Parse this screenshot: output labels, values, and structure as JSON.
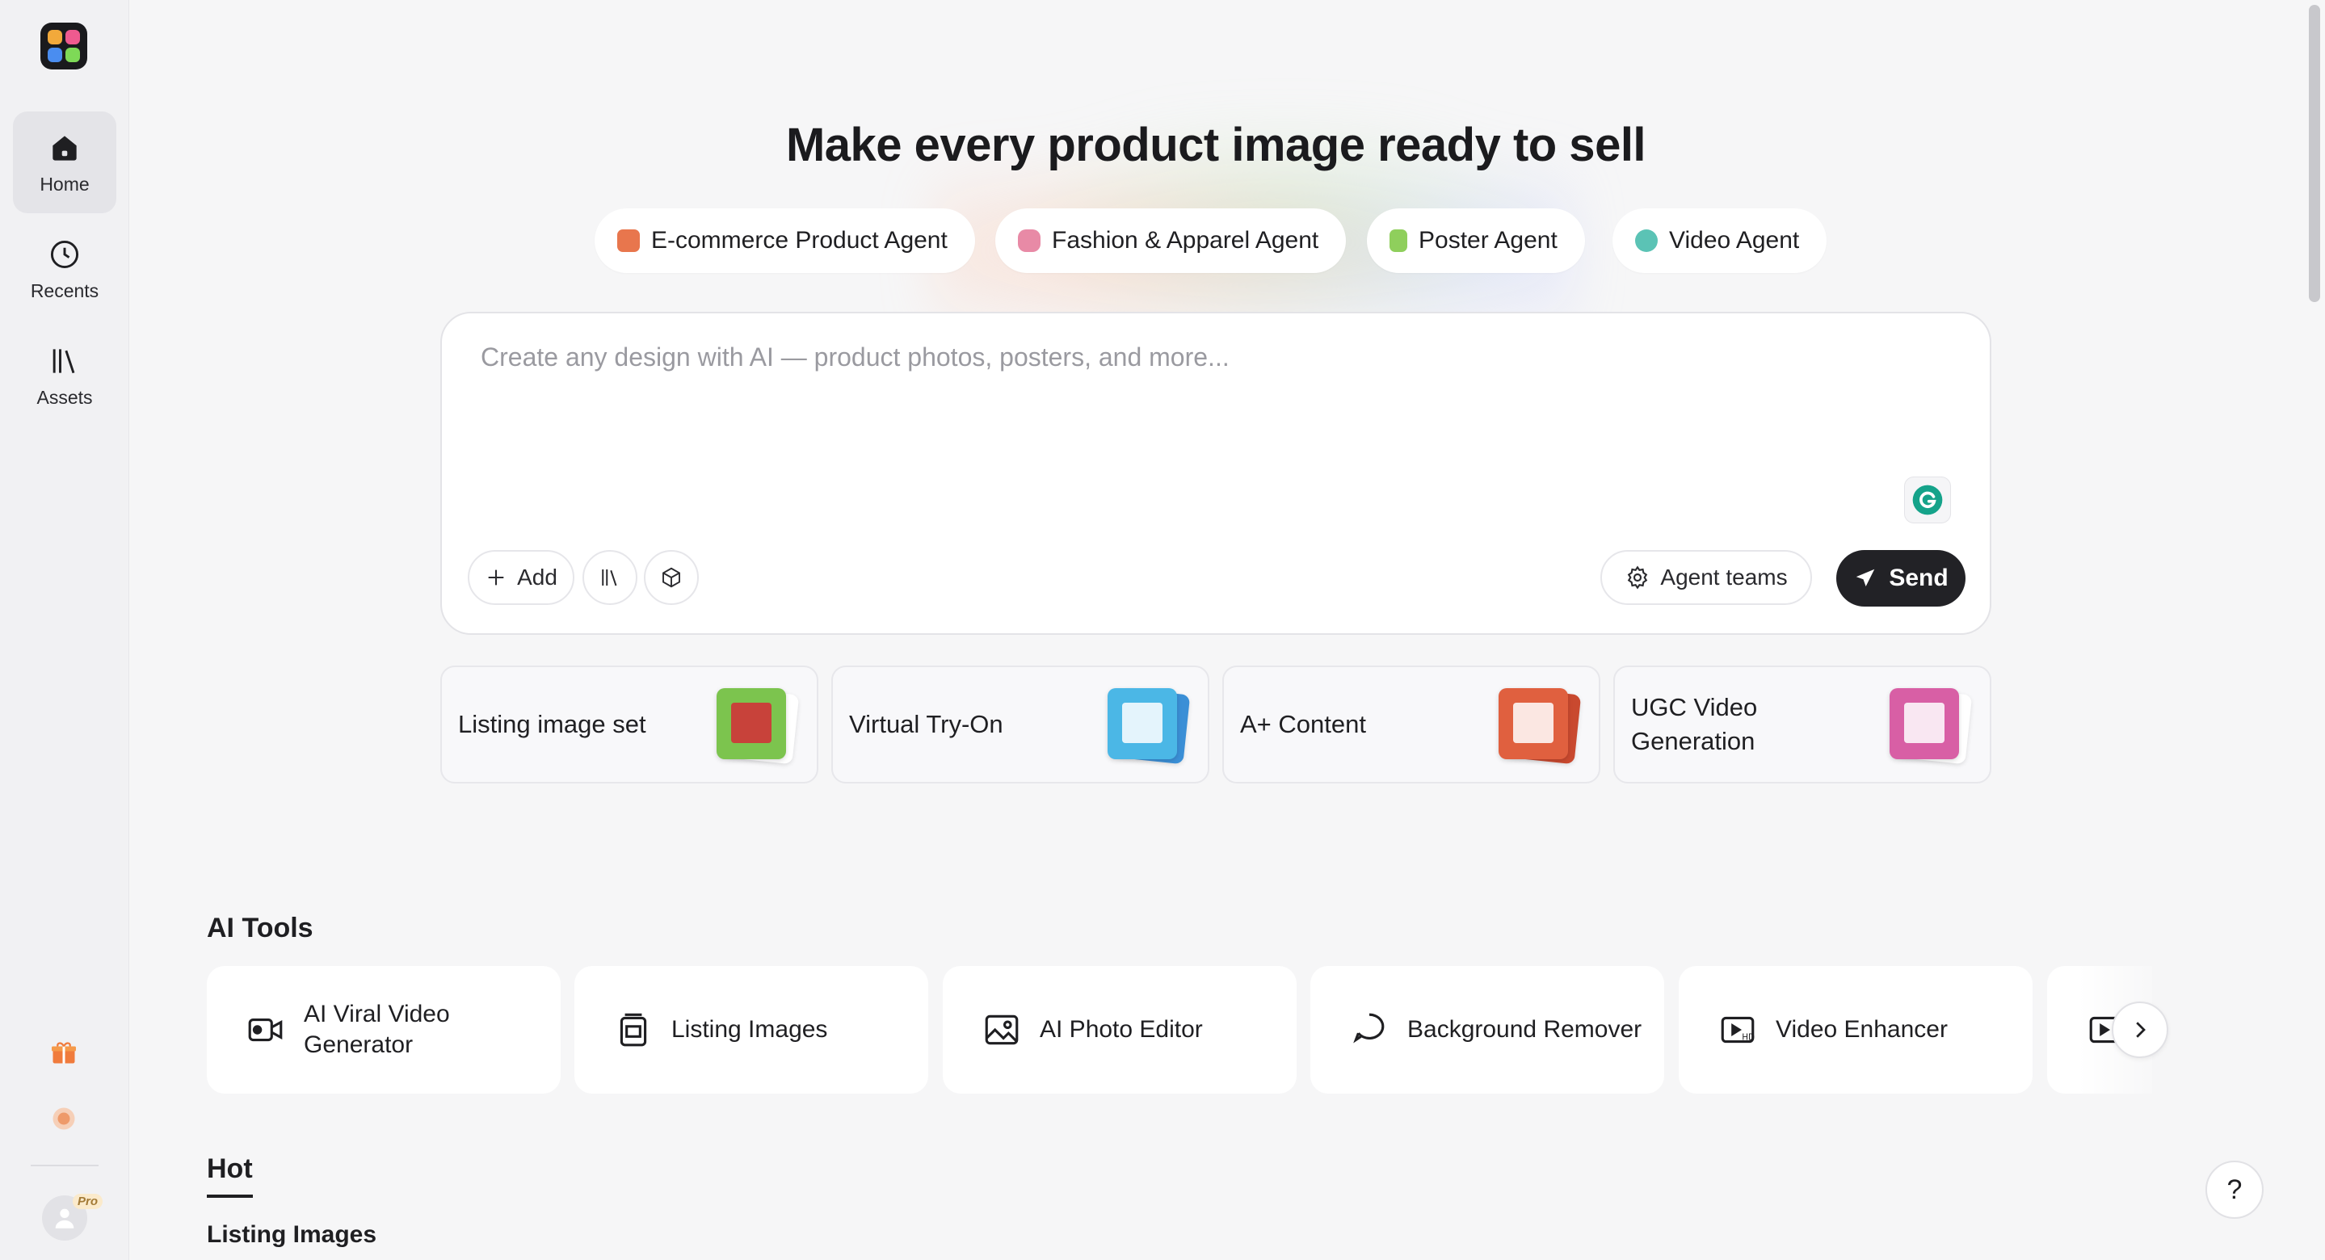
{
  "sidebar": {
    "items": [
      {
        "label": "Home",
        "icon": "home-icon",
        "active": true
      },
      {
        "label": "Recents",
        "icon": "clock-icon",
        "active": false
      },
      {
        "label": "Assets",
        "icon": "library-icon",
        "active": false
      }
    ],
    "pro_badge": "Pro"
  },
  "headline": "Make every product image ready to sell",
  "agents": [
    {
      "label": "E-commerce Product Agent",
      "icon": "sofa-icon",
      "color": "#e8764d"
    },
    {
      "label": "Fashion & Apparel Agent",
      "icon": "shirt-icon",
      "color": "#e88aa6"
    },
    {
      "label": "Poster Agent",
      "icon": "poster-icon",
      "color": "#8fcf5c"
    },
    {
      "label": "Video Agent",
      "icon": "play-icon",
      "color": "#5bc3b5"
    }
  ],
  "prompt": {
    "placeholder": "Create any design with AI — product photos, posters, and more...",
    "add_label": "Add",
    "agent_teams_label": "Agent teams",
    "send_label": "Send"
  },
  "quick_actions": [
    {
      "label": "Listing image set",
      "color": "#7cc44e"
    },
    {
      "label": "Virtual Try-On",
      "color": "#4bb7e6"
    },
    {
      "label": "A+ Content",
      "color": "#e0603f"
    },
    {
      "label": "UGC Video Generation",
      "color": "#d85fa5"
    }
  ],
  "ai_tools": {
    "title": "AI Tools",
    "items": [
      {
        "label": "AI Viral Video Generator",
        "icon": "video-camera-icon"
      },
      {
        "label": "Listing Images",
        "icon": "image-stack-icon"
      },
      {
        "label": "AI Photo Editor",
        "icon": "photo-icon"
      },
      {
        "label": "Background Remover",
        "icon": "lasso-icon"
      },
      {
        "label": "Video Enhancer",
        "icon": "hd-video-icon"
      }
    ]
  },
  "hot": {
    "tab_label": "Hot",
    "subtitle": "Listing Images"
  },
  "help_label": "?"
}
